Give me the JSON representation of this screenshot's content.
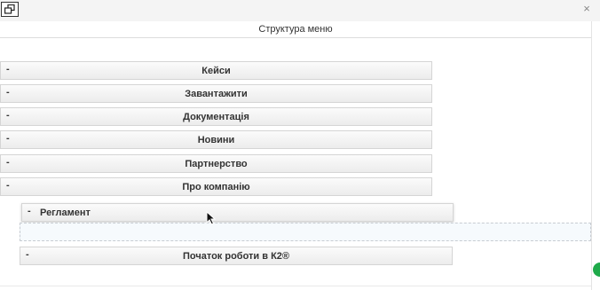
{
  "window": {
    "title": "Структура меню",
    "close_glyph": "×"
  },
  "menu_items": [
    {
      "dash": "-",
      "label": "Кейси"
    },
    {
      "dash": "-",
      "label": "Завантажити"
    },
    {
      "dash": "-",
      "label": "Документація"
    },
    {
      "dash": "-",
      "label": "Новини"
    },
    {
      "dash": "-",
      "label": "Партнерство"
    },
    {
      "dash": "-",
      "label": "Про компанію"
    }
  ],
  "dragged_item": {
    "dash": "-",
    "label": "Регламент"
  },
  "child_item": {
    "dash": "-",
    "label": "Початок роботи в К2®"
  },
  "icons": {
    "restore": "restore-window-icon",
    "close": "close-icon",
    "cursor": "mouse-pointer-icon"
  },
  "colors": {
    "bar_border": "#d5d5d5",
    "drop_zone_bg": "#f6fafd",
    "badge": "#1faa4a"
  }
}
